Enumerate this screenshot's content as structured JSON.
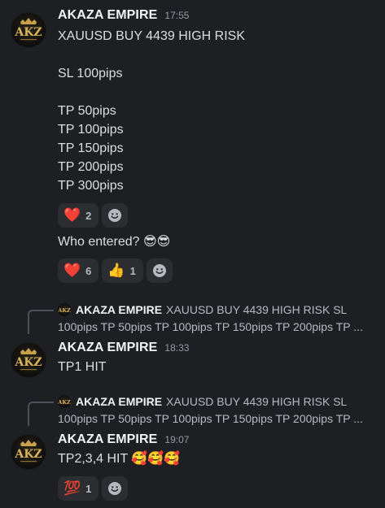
{
  "author": "AKAZA EMPIRE",
  "avatar_logo": "AKZ",
  "colors": {
    "background": "#1e1f22",
    "reaction_bg": "#2b2d31",
    "username": "#f2f3f5",
    "timestamp": "#949ba4",
    "text": "#dbdee1",
    "gold": "#c9a14a"
  },
  "messages": [
    {
      "username": "AKAZA EMPIRE",
      "time": "17:55",
      "lines": [
        "XAUUSD BUY 4439 HIGH RISK",
        "SL 100pips",
        "TP 50pips",
        "TP 100pips",
        "TP 150pips",
        "TP 200pips",
        "TP 300pips"
      ],
      "reactions": [
        {
          "emoji": "❤️",
          "icon": "heart-icon",
          "count": "2"
        }
      ],
      "followup": {
        "text": "Who entered? 😎😎",
        "reactions": [
          {
            "emoji": "❤️",
            "icon": "heart-icon",
            "count": "6"
          },
          {
            "emoji": "👍",
            "icon": "thumbs-up-icon",
            "count": "1"
          }
        ]
      }
    },
    {
      "reply": {
        "username": "AKAZA EMPIRE",
        "line1": "XAUUSD BUY 4439 HIGH RISK  SL",
        "line2": "100pips  TP 50pips TP 100pips TP 150pips TP 200pips TP ..."
      },
      "username": "AKAZA EMPIRE",
      "time": "18:33",
      "lines": [
        "TP1 HIT"
      ]
    },
    {
      "reply": {
        "username": "AKAZA EMPIRE",
        "line1": "XAUUSD BUY 4439 HIGH RISK  SL",
        "line2": "100pips  TP 50pips TP 100pips TP 150pips TP 200pips TP ..."
      },
      "username": "AKAZA EMPIRE",
      "time": "19:07",
      "lines": [
        "TP2,3,4 HIT 🥰🥰🥰"
      ],
      "reactions": [
        {
          "emoji": "💯",
          "icon": "hundred-points-icon",
          "count": "1"
        }
      ]
    }
  ]
}
